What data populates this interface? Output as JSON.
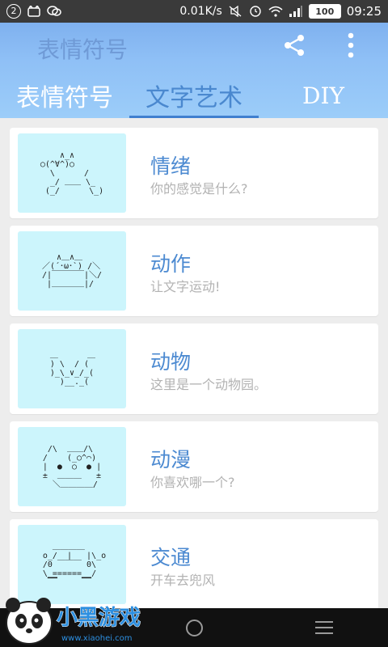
{
  "status_bar": {
    "notification_count": "2",
    "net_speed": "0.01K/s",
    "battery": "100",
    "time": "09:25",
    "icons": [
      "cat-notification-icon",
      "chat-notification-icon",
      "mute-icon",
      "alarm-icon",
      "wifi-icon",
      "signal-icon"
    ]
  },
  "header": {
    "title": "表情符号",
    "background": "#8fc0f6",
    "accent": "#3f7fcf",
    "actions": [
      "share-icon",
      "more-vertical-icon"
    ]
  },
  "tabs": [
    {
      "label": "表情符号"
    },
    {
      "label": "文字艺术"
    },
    {
      "label": "DIY"
    }
  ],
  "selected_tab": "文字艺术",
  "categories": [
    {
      "title": "情绪",
      "subtitle": "你的感觉是什么?",
      "art": "    ∧_∧\n○(^∀^)○\n  \\      /\n  _/ ＿＿ \\_\n (_/      \\_)"
    },
    {
      "title": "动作",
      "subtitle": "让文字运动!",
      "art": "   ∧＿∧＿\n／(´･ω･`) /＼\n/|￣￣￣￣|＼/\n |＿＿＿＿|/"
    },
    {
      "title": "动物",
      "subtitle": "这里是一个动物园。",
      "art": " ＿      ＿\n ) \\  / (\n )_\\_∨_/_(\n   )__._(  "
    },
    {
      "title": "动漫",
      "subtitle": "你喜欢哪一个?",
      "art": " /\\  ＿＿/\\\n/    (_○^⌒)\n|  ●  ○  ● |\n±  ＿＿＿   ±\n  ＼＿＿＿＿/"
    },
    {
      "title": "交通",
      "subtitle": "开车去兜风",
      "art": "   ＿＿＿＿\n o_/  |   |\\_o\n /0 ￣￣￣ 0\\\n \\_======__/\n  ▔▔     ▔▔"
    }
  ],
  "watermark": {
    "text": "小黑游戏",
    "url": "www.xiaohei.com"
  }
}
